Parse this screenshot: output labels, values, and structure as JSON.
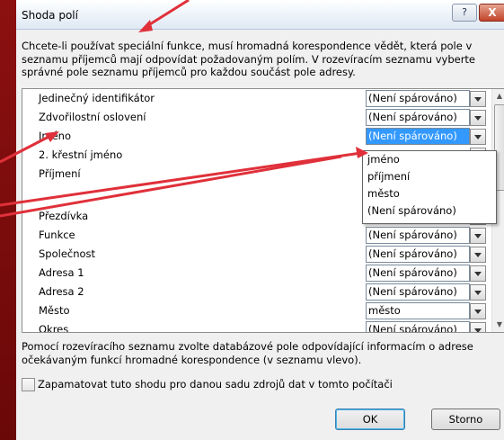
{
  "dialog": {
    "title": "Shoda polí",
    "help_label": "?",
    "close_label": "X",
    "description": "Chcete-li používat speciální funkce, musí hromadná korespondence vědět, která pole v seznamu příjemců mají odpovídat požadovaným polím. V rozevíracím seznamu vyberte správné pole seznamu příjemců pro každou součást pole adresy.",
    "fields": [
      {
        "label": "Jedinečný identifikátor",
        "value": "(Není spárováno)"
      },
      {
        "label": "Zdvořilostní oslovení",
        "value": "(Není spárováno)"
      },
      {
        "label": "Jméno",
        "value": "(Není spárováno)"
      },
      {
        "label": "2. křestní jméno",
        "value": ""
      },
      {
        "label": "Příjmení",
        "value": ""
      },
      {
        "label": "",
        "value": ""
      },
      {
        "label": "Přezdívka",
        "value": ""
      },
      {
        "label": "Funkce",
        "value": "(Není spárováno)"
      },
      {
        "label": "Společnost",
        "value": "(Není spárováno)"
      },
      {
        "label": "Adresa 1",
        "value": "(Není spárováno)"
      },
      {
        "label": "Adresa 2",
        "value": "(Není spárováno)"
      },
      {
        "label": "Město",
        "value": "město"
      },
      {
        "label": "Okres",
        "value": "(Není spárováno)"
      }
    ],
    "dropdown_options": [
      "jméno",
      "příjmení",
      "město",
      "(Není spárováno)"
    ],
    "hint": "Pomocí rozevíracího seznamu zvolte databázové pole odpovídající informacím o adrese očekávaným funkcí hromadné korespondence (v seznamu vlevo).",
    "remember_label": "Zapamatovat tuto shodu pro danou sadu zdrojů dat v tomto počítači",
    "ok_label": "OK",
    "cancel_label": "Storno"
  },
  "colors": {
    "annotation_arrow": "#e0303a",
    "background": "#7a0c0c",
    "selection": "#3399ff"
  }
}
